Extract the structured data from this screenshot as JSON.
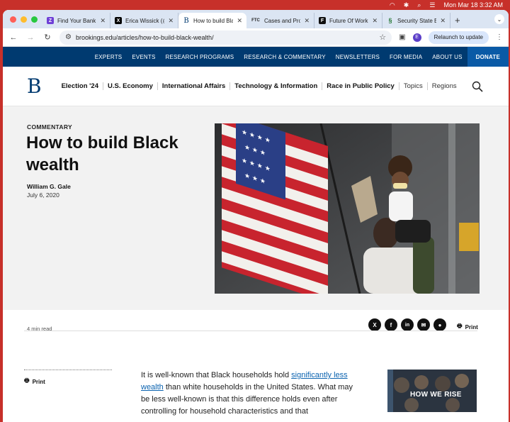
{
  "system": {
    "datetime": "Mon Mar 18  3:32 AM"
  },
  "browser": {
    "tabs": [
      {
        "label": "Find Your Bank |",
        "color": "#6e3fd6",
        "glyph": "Z"
      },
      {
        "label": "Erica Wissick (@",
        "color": "#000000",
        "glyph": "X"
      },
      {
        "label": "How to build Bla",
        "color": "#ffffff",
        "glyph": "B"
      },
      {
        "label": "Cases and Proce",
        "color": "#ffffff",
        "glyph": "FTC"
      },
      {
        "label": "Future Of Work",
        "color": "#111111",
        "glyph": "F"
      },
      {
        "label": "Security State B",
        "color": "#ffffff",
        "glyph": "§"
      }
    ],
    "url": "brookings.edu/articles/how-to-build-black-wealth/",
    "profile_initial": "E",
    "relaunch_label": "Relaunch to update"
  },
  "topnav": {
    "items": [
      "EXPERTS",
      "EVENTS",
      "RESEARCH PROGRAMS",
      "RESEARCH & COMMENTARY",
      "NEWSLETTERS",
      "FOR MEDIA",
      "ABOUT US"
    ],
    "donate": "DONATE"
  },
  "mainnav": {
    "logo": "B",
    "items": [
      "Election '24",
      "U.S. Economy",
      "International Affairs",
      "Technology & Information",
      "Race in Public Policy"
    ],
    "light_items": [
      "Topics",
      "Regions"
    ]
  },
  "article": {
    "kicker": "COMMENTARY",
    "title": "How to build Black wealth",
    "author": "William G. Gale",
    "date": "July 6, 2020",
    "read_time": "4 min read",
    "print_label": "Print",
    "share_icons": [
      "x-icon",
      "facebook-icon",
      "linkedin-icon",
      "email-icon",
      "reddit-icon"
    ],
    "body_before_link": "It is well-known that Black households hold ",
    "body_link": "significantly less wealth",
    "body_after_link": " than white households in the United States. What may be less well-known is that this difference holds even after controlling for household characteristics and that"
  },
  "promo": {
    "title": "HOW WE RISE"
  },
  "colors": {
    "brand": "#003a70",
    "donate": "#0a5aa6",
    "desktop": "#c7302a"
  }
}
